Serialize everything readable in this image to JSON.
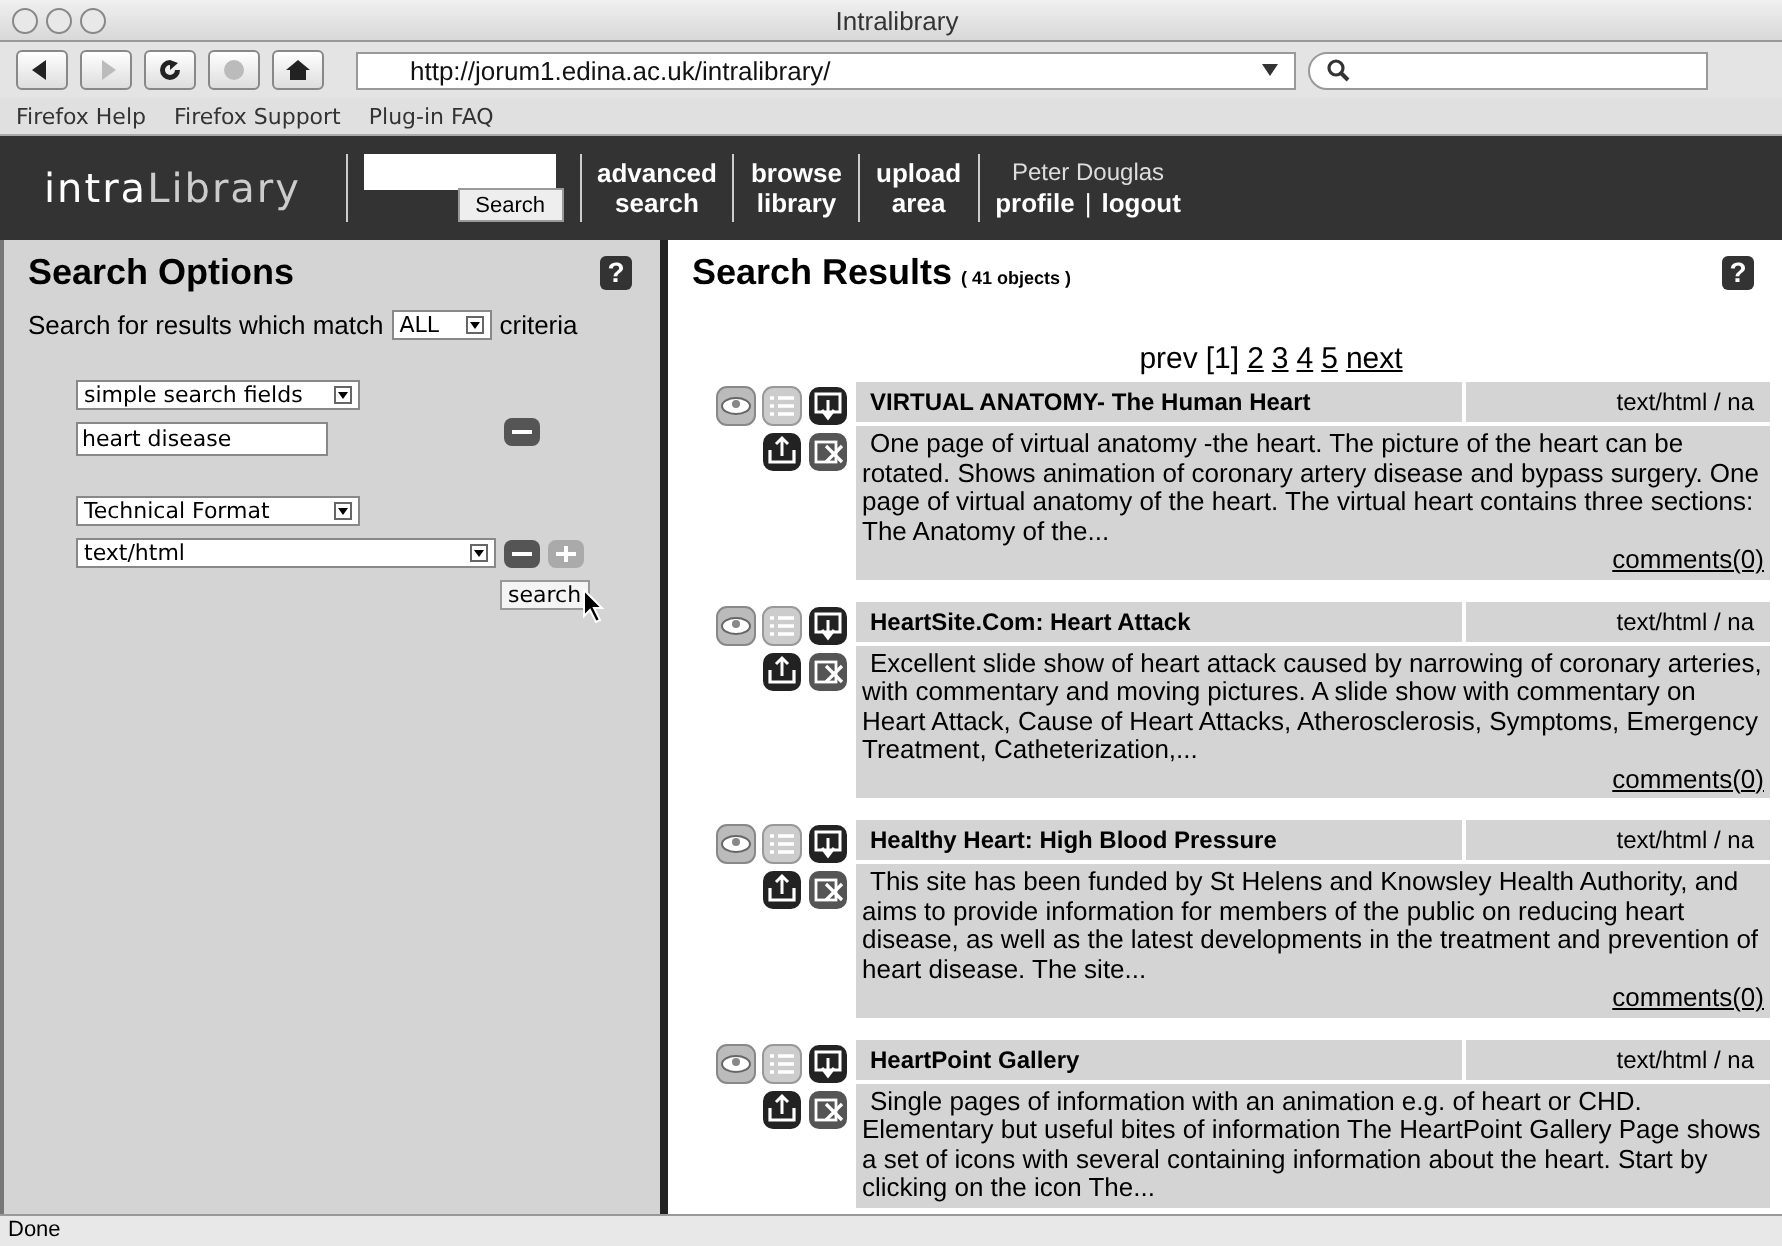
{
  "window": {
    "title": "Intralibrary"
  },
  "toolbar": {
    "buttons": [
      {
        "kind": "back",
        "disabled": false
      },
      {
        "kind": "forward",
        "disabled": true
      },
      {
        "kind": "reload",
        "disabled": false
      },
      {
        "kind": "stop",
        "disabled": true
      },
      {
        "kind": "home",
        "disabled": false
      }
    ],
    "url": "http://jorum1.edina.ac.uk/intralibrary/"
  },
  "bookmarks": [
    "Firefox Help",
    "Firefox Support",
    "Plug-in FAQ"
  ],
  "header": {
    "logo_prefix": "intra",
    "logo_suffix": "Library",
    "search_button": "Search",
    "nav": [
      "advanced search",
      "browse library",
      "upload area"
    ],
    "user": "Peter Douglas",
    "links": [
      "profile",
      "logout"
    ],
    "separator": "|"
  },
  "search_options": {
    "title": "Search Options",
    "help": "?",
    "match_before": "Search for results which match",
    "match_value": "ALL",
    "match_after": "criteria",
    "criteria": [
      {
        "field": "simple search fields",
        "kind": "text",
        "value": "heart disease",
        "add": false
      },
      {
        "field": "Technical Format",
        "kind": "select",
        "value": "text/html",
        "add": true
      }
    ],
    "search_button": "search"
  },
  "results": {
    "title": "Search Results",
    "count": "( 41 objects )",
    "help": "?",
    "prev": {
      "label": "prev",
      "link": false
    },
    "pages": [
      {
        "label": "[1]",
        "selected": true
      },
      {
        "label": "2",
        "selected": false
      },
      {
        "label": "3",
        "selected": false
      },
      {
        "label": "4",
        "selected": false
      },
      {
        "label": "5",
        "selected": false
      }
    ],
    "next": {
      "label": "next",
      "link": true
    },
    "items": [
      {
        "title": "VIRTUAL ANATOMY- The Human Heart",
        "format": "text/html / na",
        "description": "One page of virtual anatomy -the heart. The picture of the heart can be rotated. Shows animation of coronary artery disease and bypass surgery. One page of virtual anatomy of the heart. The virtual heart contains three sections: The Anatomy of the...",
        "comments": "comments(0)"
      },
      {
        "title": "HeartSite.Com: Heart Attack",
        "format": "text/html / na",
        "description": "Excellent slide show of heart attack caused by narrowing of coronary arteries, with commentary and moving pictures. A slide show with commentary on Heart Attack, Cause of Heart Attacks, Atherosclerosis, Symptoms, Emergency Treatment, Catheterization,...",
        "comments": "comments(0)"
      },
      {
        "title": "Healthy Heart: High Blood Pressure",
        "format": "text/html / na",
        "description": "This site has been funded by St Helens and Knowsley Health Authority, and aims to provide information for members of the public on reducing heart disease, as well as the latest developments in the treatment and prevention of heart disease. The site...",
        "comments": "comments(0)"
      },
      {
        "title": "HeartPoint Gallery",
        "format": "text/html / na",
        "description": "Single pages of information with an animation e.g. of heart or CHD. Elementary but useful bites of information The HeartPoint Gallery Page shows a set of icons with several containing information about the heart. Start by clicking on the icon The..."
      }
    ]
  },
  "status_bar": "Done"
}
